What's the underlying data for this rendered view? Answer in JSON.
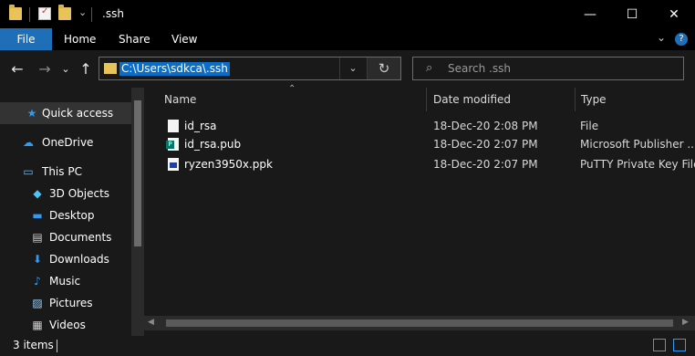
{
  "window": {
    "title": ".ssh",
    "min_glyph": "—",
    "max_glyph": "☐",
    "close_glyph": "✕"
  },
  "ribbon": {
    "tabs": [
      {
        "label": "File"
      },
      {
        "label": "Home"
      },
      {
        "label": "Share"
      },
      {
        "label": "View"
      }
    ],
    "expand_glyph": "⌄",
    "help_glyph": "?"
  },
  "nav": {
    "back_glyph": "←",
    "forward_glyph": "→",
    "recent_glyph": "⌄",
    "up_glyph": "↑"
  },
  "address": {
    "path": "C:\\Users\\sdkca\\.ssh",
    "dropdown_glyph": "⌄",
    "refresh_glyph": "↻"
  },
  "search": {
    "placeholder": "Search .ssh",
    "icon_glyph": "⌕"
  },
  "sidebar": {
    "items": [
      {
        "label": "Quick access",
        "icon": "star-icon",
        "glyph": "★",
        "color": "#2f9bf2"
      },
      {
        "label": "OneDrive",
        "icon": "cloud-icon",
        "glyph": "☁",
        "color": "#2f9bf2"
      },
      {
        "label": "This PC",
        "icon": "computer-icon",
        "glyph": "▭",
        "color": "#6fb9f0"
      },
      {
        "label": "3D Objects",
        "icon": "cube-icon",
        "glyph": "◆",
        "color": "#4fc3f7"
      },
      {
        "label": "Desktop",
        "icon": "desktop-icon",
        "glyph": "▬",
        "color": "#2f9bf2"
      },
      {
        "label": "Documents",
        "icon": "document-icon",
        "glyph": "▤",
        "color": "#cfcfcf"
      },
      {
        "label": "Downloads",
        "icon": "download-icon",
        "glyph": "⬇",
        "color": "#2f9bf2"
      },
      {
        "label": "Music",
        "icon": "music-icon",
        "glyph": "♪",
        "color": "#2f9bf2"
      },
      {
        "label": "Pictures",
        "icon": "pictures-icon",
        "glyph": "▨",
        "color": "#9fd0f5"
      },
      {
        "label": "Videos",
        "icon": "videos-icon",
        "glyph": "▦",
        "color": "#cfcfcf"
      }
    ]
  },
  "columns": {
    "name": "Name",
    "date": "Date modified",
    "type": "Type",
    "sort_glyph": "⌃"
  },
  "files": [
    {
      "name": "id_rsa",
      "date": "18-Dec-20 2:08 PM",
      "type": "File",
      "icon": "file-icon"
    },
    {
      "name": "id_rsa.pub",
      "date": "18-Dec-20 2:07 PM",
      "type": "Microsoft Publisher ...",
      "icon": "publisher-icon"
    },
    {
      "name": "ryzen3950x.ppk",
      "date": "18-Dec-20 2:07 PM",
      "type": "PuTTY Private Key File",
      "icon": "putty-key-icon"
    }
  ],
  "status": {
    "items_count": "3 items"
  },
  "colors": {
    "accent": "#1f6fb8",
    "selection": "#0b6dc7",
    "folder": "#e8c35a"
  }
}
